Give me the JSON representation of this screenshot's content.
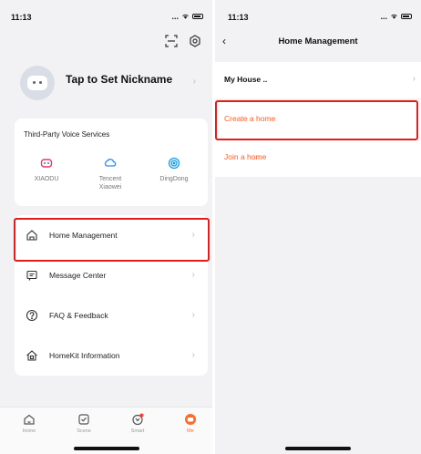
{
  "colors": {
    "accent": "#ff5a1f",
    "highlight": "#e21b1b",
    "background": "#f2f2f4"
  },
  "left_screen": {
    "status": {
      "time": "11:13",
      "signal": "...",
      "wifi_icon": "wifi-icon",
      "battery_icon": "battery-icon"
    },
    "header_icons": [
      "scan-icon",
      "settings-gear-icon"
    ],
    "profile": {
      "nickname": "Tap to Set Nickname"
    },
    "voice_services": {
      "title": "Third-Party Voice Services",
      "items": [
        {
          "label": "XIAODU",
          "icon": "xiaodu-icon"
        },
        {
          "label": "Tencent\nXiaowei",
          "icon": "tencent-xiaowei-icon"
        },
        {
          "label": "DingDong",
          "icon": "dingdong-icon"
        }
      ]
    },
    "menu": [
      {
        "label": "Home Management",
        "icon": "home-icon"
      },
      {
        "label": "Message Center",
        "icon": "message-icon"
      },
      {
        "label": "FAQ & Feedback",
        "icon": "help-icon"
      },
      {
        "label": "HomeKit Information",
        "icon": "homekit-icon"
      }
    ],
    "tabs": [
      {
        "label": "Home",
        "icon": "home-tab-icon",
        "active": false
      },
      {
        "label": "Scene",
        "icon": "scene-tab-icon",
        "active": false
      },
      {
        "label": "Smart",
        "icon": "smart-tab-icon",
        "active": false
      },
      {
        "label": "Me",
        "icon": "me-tab-icon",
        "active": true
      }
    ]
  },
  "right_screen": {
    "status": {
      "time": "11:13",
      "signal": "...",
      "wifi_icon": "wifi-icon",
      "battery_icon": "battery-icon"
    },
    "title": "Home Management",
    "house": {
      "label": "My House  .."
    },
    "actions": [
      {
        "label": "Create a home"
      },
      {
        "label": "Join a home"
      }
    ]
  }
}
